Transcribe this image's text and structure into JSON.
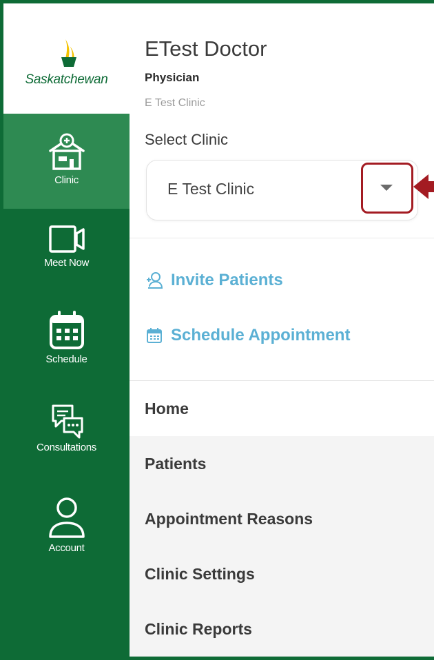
{
  "brand": {
    "name": "Saskatchewan",
    "colors": {
      "primary": "#0e6b36",
      "active": "#2e8a52",
      "link": "#5bb0d4",
      "highlight": "#a31b22"
    }
  },
  "sidebar": {
    "items": [
      {
        "label": "Clinic",
        "icon": "clinic-icon",
        "active": true
      },
      {
        "label": "Meet Now",
        "icon": "video-camera-icon"
      },
      {
        "label": "Schedule",
        "icon": "calendar-icon"
      },
      {
        "label": "Consultations",
        "icon": "chat-bubbles-icon"
      },
      {
        "label": "Account",
        "icon": "user-icon"
      }
    ]
  },
  "profile": {
    "name": "ETest Doctor",
    "role": "Physician",
    "clinic": "E Test Clinic"
  },
  "clinic_select": {
    "label": "Select Clinic",
    "value": "E Test Clinic"
  },
  "actions": [
    {
      "label": "Invite Patients",
      "icon": "invite-user-icon"
    },
    {
      "label": "Schedule Appointment",
      "icon": "calendar-icon"
    }
  ],
  "menu": [
    {
      "label": "Home",
      "active": true
    },
    {
      "label": "Patients"
    },
    {
      "label": "Appointment Reasons"
    },
    {
      "label": "Clinic Settings"
    },
    {
      "label": "Clinic Reports"
    }
  ]
}
